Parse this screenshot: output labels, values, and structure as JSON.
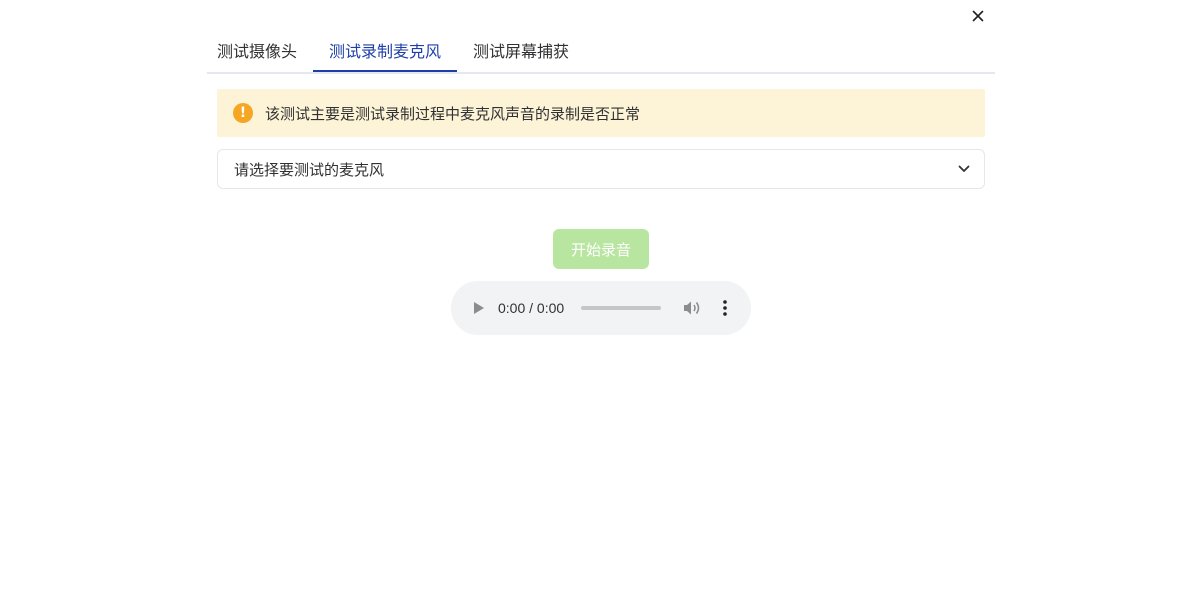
{
  "tabs": [
    {
      "label": "测试摄像头",
      "active": false
    },
    {
      "label": "测试录制麦克风",
      "active": true
    },
    {
      "label": "测试屏幕捕获",
      "active": false
    }
  ],
  "alert": {
    "icon": "warning-circle-icon",
    "text": "该测试主要是测试录制过程中麦克风声音的录制是否正常"
  },
  "microphone_select": {
    "placeholder": "请选择要测试的麦克风",
    "icon": "chevron-down-icon"
  },
  "record_button": {
    "label": "开始录音",
    "enabled": false
  },
  "audio_player": {
    "time": "0:00 / 0:00",
    "progress": 0
  },
  "colors": {
    "active_tab": "#1e3fa8",
    "alert_background": "#fdf3d6",
    "alert_icon": "#f5a623",
    "record_button": "#b8e6a1",
    "audio_background": "#f1f3f4"
  }
}
